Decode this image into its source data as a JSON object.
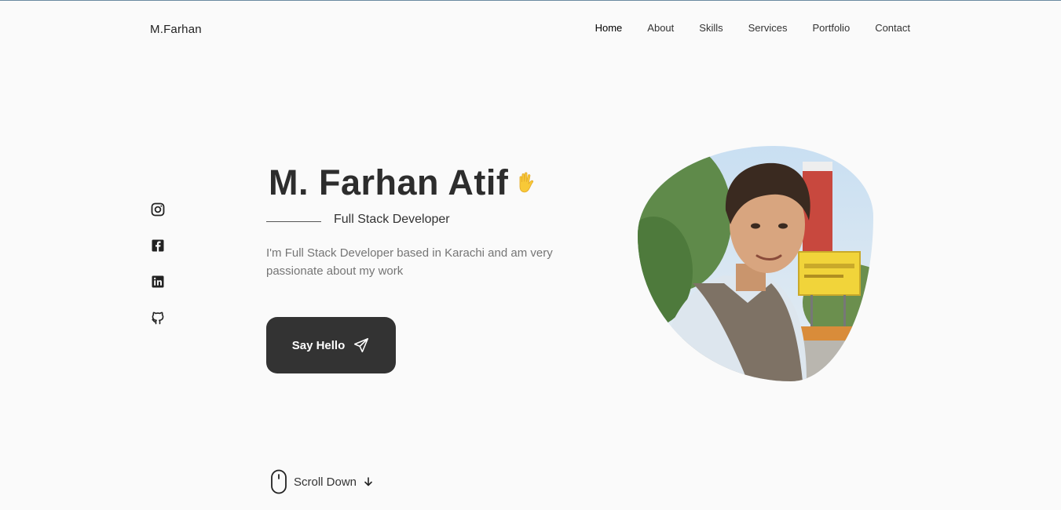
{
  "header": {
    "logo": "M.Farhan",
    "nav": [
      "Home",
      "About",
      "Skills",
      "Services",
      "Portfolio",
      "Contact"
    ]
  },
  "social": [
    "instagram-icon",
    "facebook-icon",
    "linkedin-icon",
    "github-icon"
  ],
  "hero": {
    "name": "M. Farhan Atif",
    "role": "Full Stack Developer",
    "description": "I'm Full Stack Developer based in Karachi and am very passionate about my work",
    "cta_label": "Say Hello"
  },
  "scroll": {
    "label": "Scroll Down"
  },
  "colors": {
    "text": "#333333",
    "button": "#333333",
    "muted": "#757575",
    "background": "#fafafa"
  }
}
